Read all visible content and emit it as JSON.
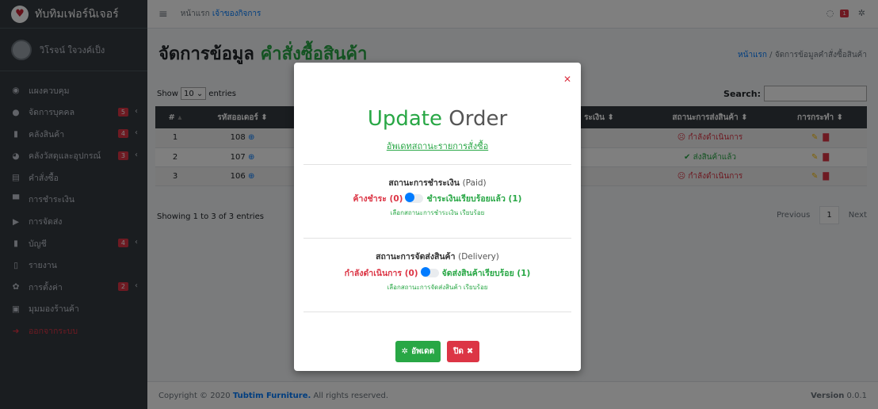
{
  "brand": {
    "name": "ทับทิมเฟอร์นิเจอร์"
  },
  "user": {
    "name": "วิโรจน์ ใจวงค์เป็ง"
  },
  "sidebar": {
    "items": [
      {
        "label": "แผงควบคุม",
        "icon": "dashboard-icon",
        "badge": null
      },
      {
        "label": "จัดการบุคคล",
        "icon": "user-icon",
        "badge": "5"
      },
      {
        "label": "คลังสินค้า",
        "icon": "copy-icon",
        "badge": "4"
      },
      {
        "label": "คลังวัสดุและอุปกรณ์",
        "icon": "pie-icon",
        "badge": "3"
      },
      {
        "label": "คำสั่งซื้อ",
        "icon": "list-icon",
        "badge": null
      },
      {
        "label": "การชำระเงิน",
        "icon": "cash-icon",
        "badge": null
      },
      {
        "label": "การจัดส่ง",
        "icon": "truck-icon",
        "badge": null
      },
      {
        "label": "บัญชี",
        "icon": "copy-icon",
        "badge": "4"
      },
      {
        "label": "รายงาน",
        "icon": "file-icon",
        "badge": null
      },
      {
        "label": "การตั้งค่า",
        "icon": "cogs-icon",
        "badge": "2"
      },
      {
        "label": "มุมมองร้านค้า",
        "icon": "store-icon",
        "badge": null
      },
      {
        "label": "ออกจากระบบ",
        "icon": "logout-icon",
        "badge": null
      }
    ]
  },
  "header": {
    "crumb_home": "หน้าแรก",
    "crumb_owner": "เจ้าของกิจการ",
    "notif_count": "1"
  },
  "page": {
    "title_main": "จัดการข้อมูล",
    "title_accent": "คำสั่งซื้อสินค้า",
    "crumb_home": "หน้าแรก",
    "crumb_sep": "/",
    "crumb_current": "จัดการข้อมูลคำสั่งซื้อสินค้า",
    "show_label": "Show",
    "show_value": "10",
    "entries_label": "entries",
    "search_label": "Search:",
    "info": "Showing 1 to 3 of 3 entries",
    "prev": "Previous",
    "page_num": "1",
    "next": "Next"
  },
  "table": {
    "headers": [
      "#",
      "รหัสออเดอร์",
      "",
      "ระเงิน",
      "สถานะการส่งสินค้า",
      "การกระทำ"
    ],
    "rows": [
      {
        "no": "1",
        "order": "108",
        "status": "กำลังดำเนินการ",
        "done": false
      },
      {
        "no": "2",
        "order": "107",
        "status": "ส่งสินค้าแล้ว",
        "done": true
      },
      {
        "no": "3",
        "order": "106",
        "status": "กำลังดำเนินการ",
        "done": false
      }
    ]
  },
  "footer": {
    "copy_prefix": "Copyright © 2020",
    "company": "Tubtim Furniture.",
    "copy_suffix": "All rights reserved.",
    "version_label": "Version",
    "version": "0.0.1"
  },
  "modal": {
    "title_accent": "Update",
    "title_rest": "Order",
    "subtitle": "อัพเดทสถานะรายการสั่งซื้อ",
    "paid_title": "สถานะการชำระเงิน",
    "paid_title_en": "(Paid)",
    "paid_off": "ค้างชำระ (0)",
    "paid_on": "ชำระเงินเรียบร้อยแล้ว (1)",
    "paid_hint": "เลือกสถานะการชำระเงิน เรียบร้อย",
    "del_title": "สถานะการจัดส่งสินค้า",
    "del_title_en": "(Delivery)",
    "del_off": "กำลังดำเนินการ (0)",
    "del_on": "จัดส่งสินค้าเรียบร้อย (1)",
    "del_hint": "เลือกสถานะการจัดส่งสินค้า เรียบร้อย",
    "update_btn": "อัพเดต",
    "close_btn": "ปิด"
  },
  "colors": {
    "accent": "#28a745",
    "danger": "#dc3545",
    "primary": "#007bff",
    "sidebar": "#343a40"
  }
}
